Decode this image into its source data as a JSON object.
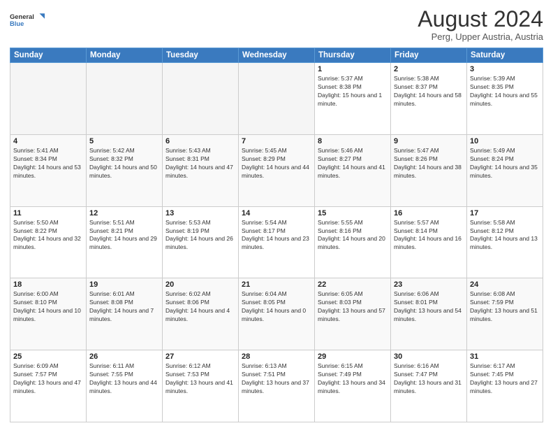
{
  "logo": {
    "line1": "General",
    "line2": "Blue"
  },
  "title": "August 2024",
  "subtitle": "Perg, Upper Austria, Austria",
  "days_of_week": [
    "Sunday",
    "Monday",
    "Tuesday",
    "Wednesday",
    "Thursday",
    "Friday",
    "Saturday"
  ],
  "weeks": [
    [
      {
        "day": "",
        "empty": true
      },
      {
        "day": "",
        "empty": true
      },
      {
        "day": "",
        "empty": true
      },
      {
        "day": "",
        "empty": true
      },
      {
        "day": "1",
        "rise": "5:37 AM",
        "set": "8:38 PM",
        "daylight": "15 hours and 1 minute."
      },
      {
        "day": "2",
        "rise": "5:38 AM",
        "set": "8:37 PM",
        "daylight": "14 hours and 58 minutes."
      },
      {
        "day": "3",
        "rise": "5:39 AM",
        "set": "8:35 PM",
        "daylight": "14 hours and 55 minutes."
      }
    ],
    [
      {
        "day": "4",
        "rise": "5:41 AM",
        "set": "8:34 PM",
        "daylight": "14 hours and 53 minutes."
      },
      {
        "day": "5",
        "rise": "5:42 AM",
        "set": "8:32 PM",
        "daylight": "14 hours and 50 minutes."
      },
      {
        "day": "6",
        "rise": "5:43 AM",
        "set": "8:31 PM",
        "daylight": "14 hours and 47 minutes."
      },
      {
        "day": "7",
        "rise": "5:45 AM",
        "set": "8:29 PM",
        "daylight": "14 hours and 44 minutes."
      },
      {
        "day": "8",
        "rise": "5:46 AM",
        "set": "8:27 PM",
        "daylight": "14 hours and 41 minutes."
      },
      {
        "day": "9",
        "rise": "5:47 AM",
        "set": "8:26 PM",
        "daylight": "14 hours and 38 minutes."
      },
      {
        "day": "10",
        "rise": "5:49 AM",
        "set": "8:24 PM",
        "daylight": "14 hours and 35 minutes."
      }
    ],
    [
      {
        "day": "11",
        "rise": "5:50 AM",
        "set": "8:22 PM",
        "daylight": "14 hours and 32 minutes."
      },
      {
        "day": "12",
        "rise": "5:51 AM",
        "set": "8:21 PM",
        "daylight": "14 hours and 29 minutes."
      },
      {
        "day": "13",
        "rise": "5:53 AM",
        "set": "8:19 PM",
        "daylight": "14 hours and 26 minutes."
      },
      {
        "day": "14",
        "rise": "5:54 AM",
        "set": "8:17 PM",
        "daylight": "14 hours and 23 minutes."
      },
      {
        "day": "15",
        "rise": "5:55 AM",
        "set": "8:16 PM",
        "daylight": "14 hours and 20 minutes."
      },
      {
        "day": "16",
        "rise": "5:57 AM",
        "set": "8:14 PM",
        "daylight": "14 hours and 16 minutes."
      },
      {
        "day": "17",
        "rise": "5:58 AM",
        "set": "8:12 PM",
        "daylight": "14 hours and 13 minutes."
      }
    ],
    [
      {
        "day": "18",
        "rise": "6:00 AM",
        "set": "8:10 PM",
        "daylight": "14 hours and 10 minutes."
      },
      {
        "day": "19",
        "rise": "6:01 AM",
        "set": "8:08 PM",
        "daylight": "14 hours and 7 minutes."
      },
      {
        "day": "20",
        "rise": "6:02 AM",
        "set": "8:06 PM",
        "daylight": "14 hours and 4 minutes."
      },
      {
        "day": "21",
        "rise": "6:04 AM",
        "set": "8:05 PM",
        "daylight": "14 hours and 0 minutes."
      },
      {
        "day": "22",
        "rise": "6:05 AM",
        "set": "8:03 PM",
        "daylight": "13 hours and 57 minutes."
      },
      {
        "day": "23",
        "rise": "6:06 AM",
        "set": "8:01 PM",
        "daylight": "13 hours and 54 minutes."
      },
      {
        "day": "24",
        "rise": "6:08 AM",
        "set": "7:59 PM",
        "daylight": "13 hours and 51 minutes."
      }
    ],
    [
      {
        "day": "25",
        "rise": "6:09 AM",
        "set": "7:57 PM",
        "daylight": "13 hours and 47 minutes."
      },
      {
        "day": "26",
        "rise": "6:11 AM",
        "set": "7:55 PM",
        "daylight": "13 hours and 44 minutes."
      },
      {
        "day": "27",
        "rise": "6:12 AM",
        "set": "7:53 PM",
        "daylight": "13 hours and 41 minutes."
      },
      {
        "day": "28",
        "rise": "6:13 AM",
        "set": "7:51 PM",
        "daylight": "13 hours and 37 minutes."
      },
      {
        "day": "29",
        "rise": "6:15 AM",
        "set": "7:49 PM",
        "daylight": "13 hours and 34 minutes."
      },
      {
        "day": "30",
        "rise": "6:16 AM",
        "set": "7:47 PM",
        "daylight": "13 hours and 31 minutes."
      },
      {
        "day": "31",
        "rise": "6:17 AM",
        "set": "7:45 PM",
        "daylight": "13 hours and 27 minutes."
      }
    ]
  ]
}
